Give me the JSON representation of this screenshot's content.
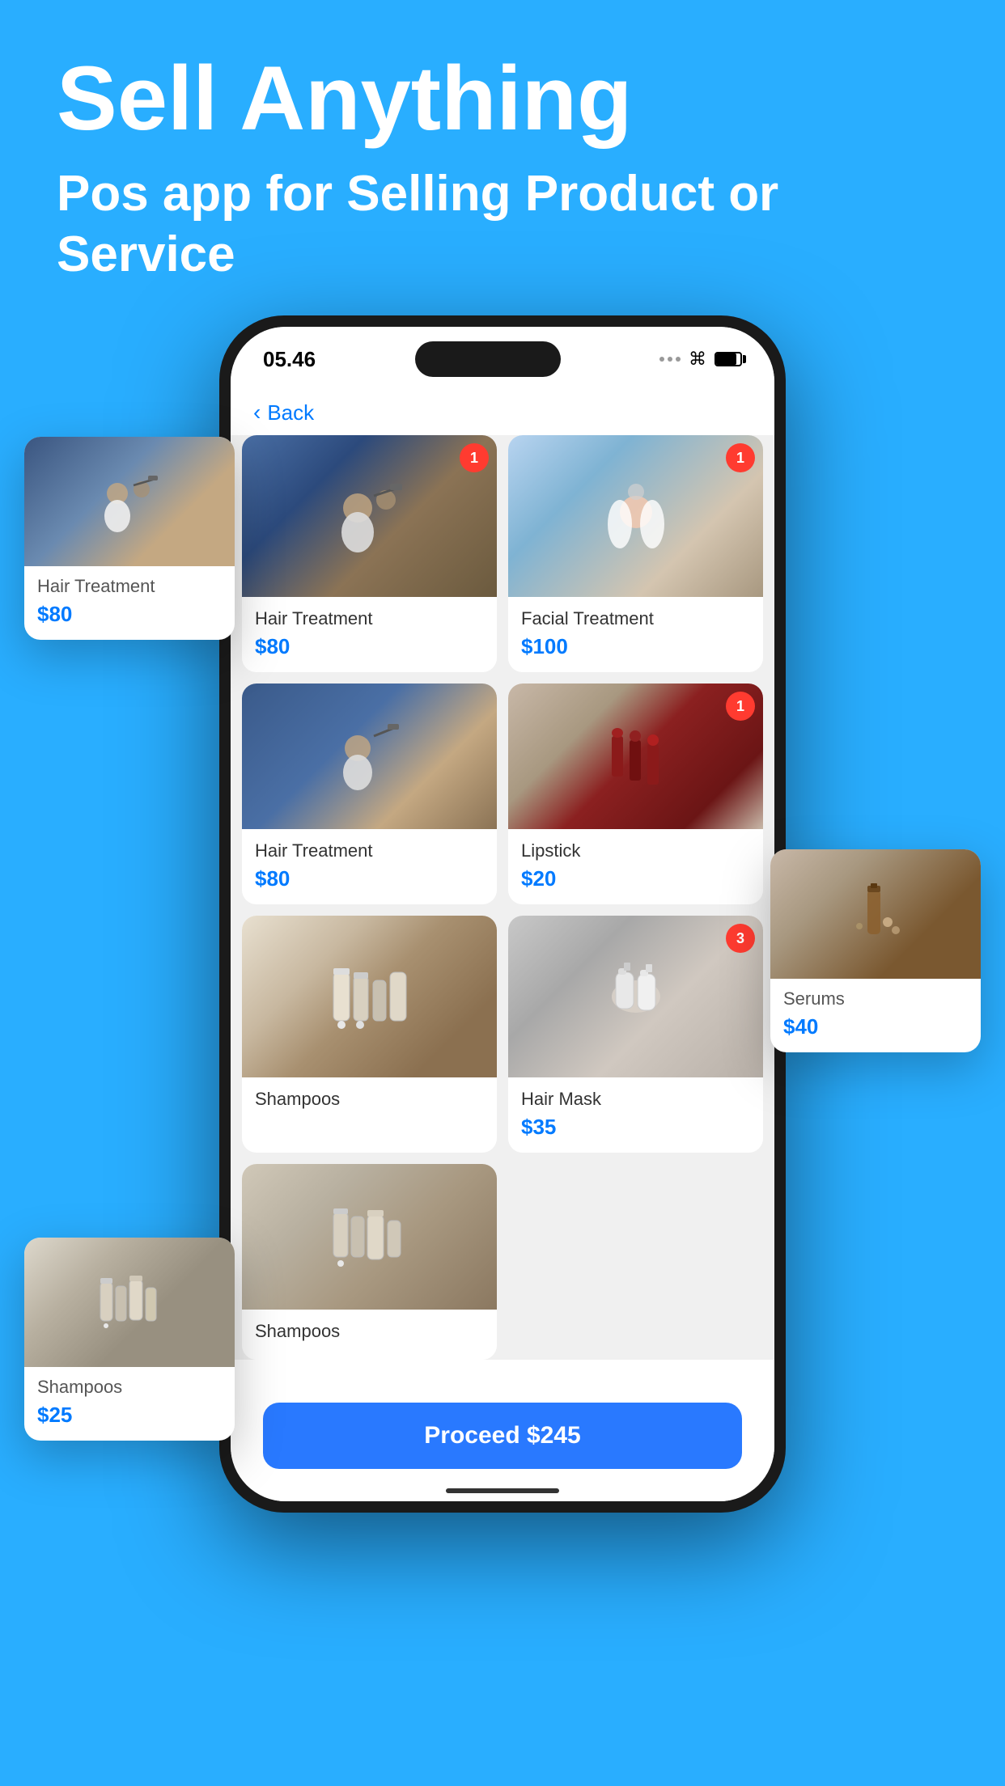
{
  "background_color": "#29AEFF",
  "hero": {
    "title": "Sell Anything",
    "subtitle": "Pos app for Selling Product or Service"
  },
  "phone": {
    "status": {
      "time": "05.46",
      "icons": [
        "dots",
        "wifi",
        "battery"
      ]
    },
    "back_label": "Back",
    "products": [
      {
        "id": "hair-treatment-1",
        "name": "Hair Treatment",
        "price": "$80",
        "badge": "1",
        "img_class": "img-hair-treatment"
      },
      {
        "id": "facial-treatment",
        "name": "Facial Treatment",
        "price": "$100",
        "badge": "1",
        "img_class": "img-facial"
      },
      {
        "id": "hair-treatment-2",
        "name": "Hair Treatment",
        "price": "$80",
        "badge": null,
        "img_class": "img-hair-treatment2"
      },
      {
        "id": "lipstick",
        "name": "Lipstick",
        "price": "$20",
        "badge": "1",
        "img_class": "img-lipstick"
      },
      {
        "id": "shampoos-1",
        "name": "Shampoos",
        "price": "",
        "badge": null,
        "img_class": "img-shampoos"
      },
      {
        "id": "hair-mask",
        "name": "Hair Mask",
        "price": "$35",
        "badge": "3",
        "img_class": "img-hairmask"
      },
      {
        "id": "shampoos-2",
        "name": "Shampoos",
        "price": "",
        "badge": null,
        "img_class": "img-shampoos2"
      }
    ],
    "proceed_label": "Proceed $245"
  },
  "floating_cards": [
    {
      "id": "float-hair",
      "name": "Hair Treatment",
      "price": "$80",
      "position": "top-left"
    },
    {
      "id": "float-serums",
      "name": "Serums",
      "price": "$40",
      "position": "right"
    },
    {
      "id": "float-shampoos",
      "name": "Shampoos",
      "price": "$25",
      "position": "left"
    }
  ]
}
